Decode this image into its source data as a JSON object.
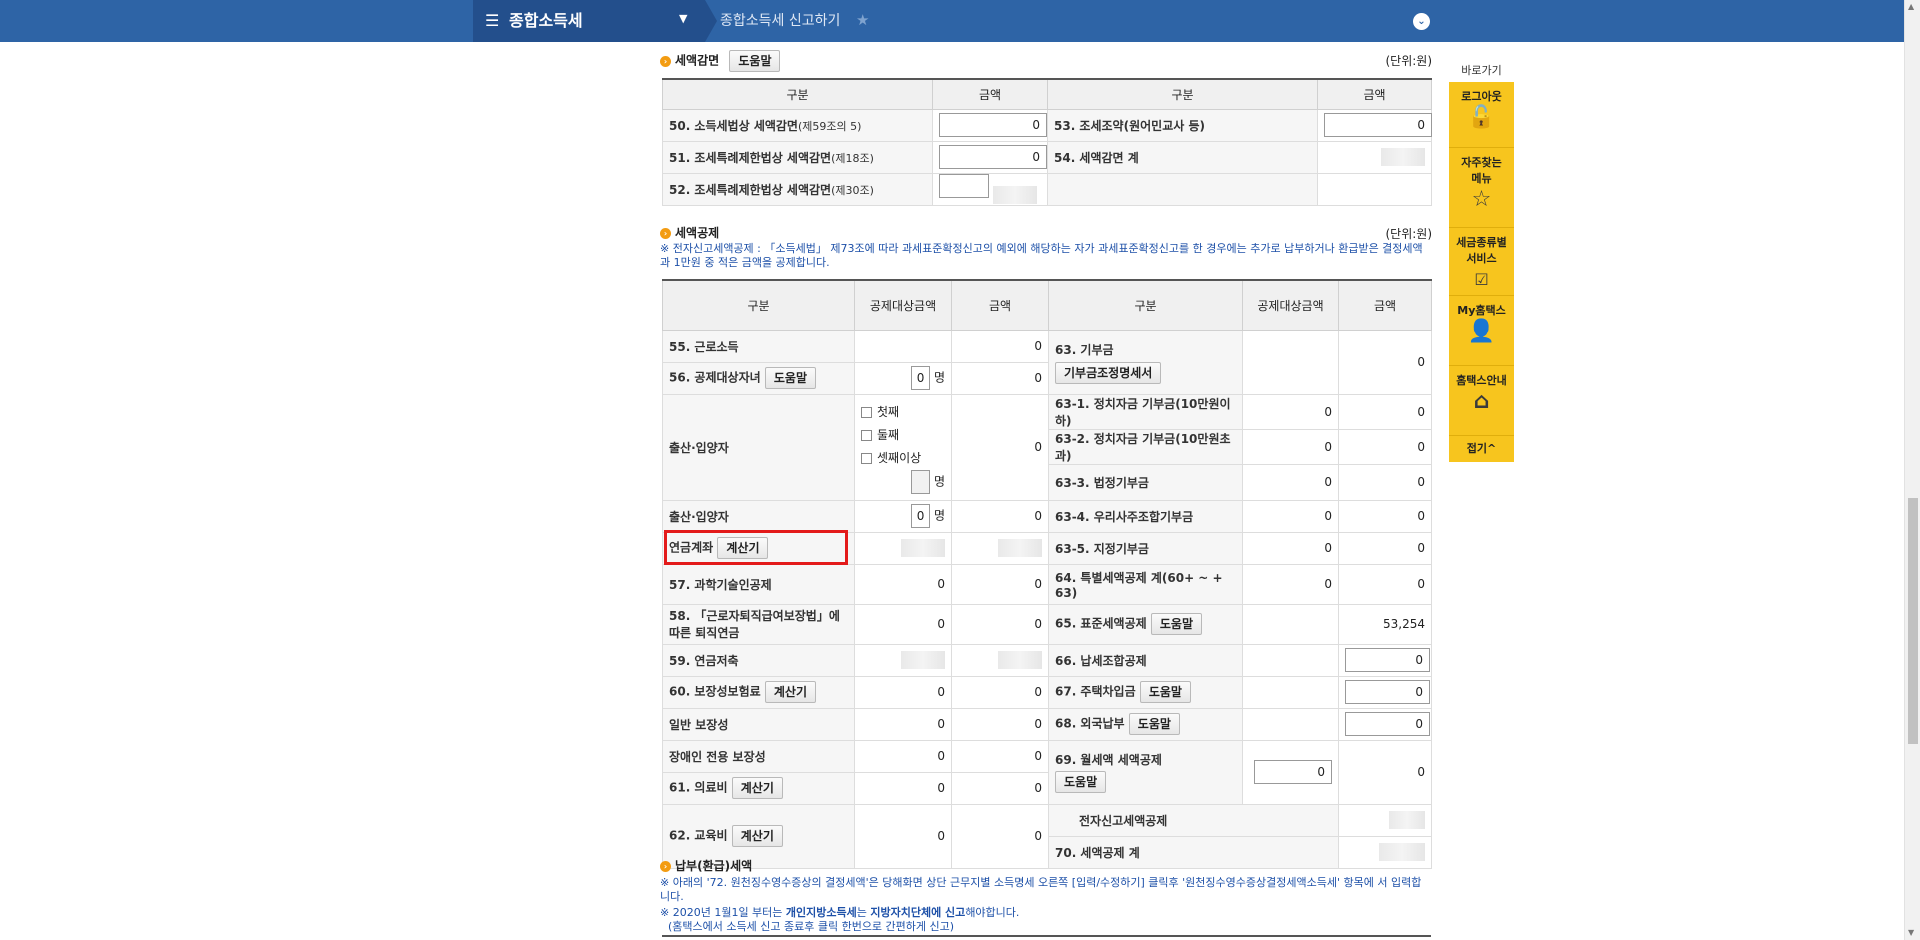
{
  "topbar": {
    "menu_icon": "☰",
    "menu_title": "종합소득세",
    "caret": "▼",
    "breadcrumb": "종합소득세 신고하기",
    "star": "★",
    "chevron": "⌄"
  },
  "reduction": {
    "title": "세액감면",
    "help": "도움말",
    "unit": "(단위:원)",
    "headers": [
      "구분",
      "금액",
      "구분",
      "금액"
    ],
    "r50_label": "50. 소득세법상 세액감면",
    "r50_small": "(제59조의 5)",
    "r50_value": "0",
    "r51_label": "51. 조세특례제한법상 세액감면",
    "r51_small": "(제18조)",
    "r51_value": "0",
    "r52_label": "52. 조세특례제한법상 세액감면",
    "r52_small": "(제30조)",
    "r53_label": "53. 조세조약(원어민교사 등)",
    "r53_value": "0",
    "r54_label": "54. 세액감면 계"
  },
  "deduction": {
    "title": "세액공제",
    "unit": "(단위:원)",
    "note": "※ 전자신고세액공제 : 「소득세법」 제73조에 따라 과세표준확정신고의 예외에 해당하는 자가 과세표준확정신고를 한 경우에는 추가로 납부하거나 환급받은 결정세액과 1만원 중 적은 금액을 공제합니다.",
    "headers": [
      "구분",
      "공제대상금액",
      "금액",
      "구분",
      "공제대상금액",
      "금액"
    ],
    "r55": "55. 근로소득",
    "r55_v": "0",
    "r56": "56. 공제대상자녀",
    "r56_btn": "도움말",
    "r56_count": "0",
    "r56_unit": "명",
    "r56_v": "0",
    "birth_label": "출산·입양자",
    "birth_opts": [
      "첫째",
      "둘째",
      "셋째이상"
    ],
    "birth_unit": "명",
    "birth_v": "0",
    "birth2_label": "출산·입양자",
    "birth2_count": "0",
    "birth2_unit": "명",
    "birth2_v": "0",
    "pension_label": "연금계좌",
    "pension_btn": "계산기",
    "r57": "57. 과학기술인공제",
    "r57_t": "0",
    "r57_v": "0",
    "r58": "58. 「근로자퇴직급여보장법」에 따른 퇴직연금",
    "r58_t": "0",
    "r58_v": "0",
    "r59": "59. 연금저축",
    "r60": "60. 보장성보험료",
    "r60_btn": "계산기",
    "r60_t": "0",
    "r60_v": "0",
    "gen_label": "일반 보장성",
    "gen_t": "0",
    "gen_v": "0",
    "dis_label": "장애인 전용 보장성",
    "dis_t": "0",
    "dis_v": "0",
    "r61": "61. 의료비",
    "r61_btn": "계산기",
    "r61_t": "0",
    "r61_v": "0",
    "r62": "62. 교육비",
    "r62_btn": "계산기",
    "r62_t": "0",
    "r62_v": "0",
    "r63": "63. 기부금",
    "r63_btn": "기부금조정명세서",
    "r63_v": "0",
    "r631": "63-1. 정치자금 기부금(10만원이하)",
    "r631_t": "0",
    "r631_v": "0",
    "r632": "63-2. 정치자금 기부금(10만원초과)",
    "r632_t": "0",
    "r632_v": "0",
    "r633": "63-3. 법정기부금",
    "r633_t": "0",
    "r633_v": "0",
    "r634": "63-4. 우리사주조합기부금",
    "r634_t": "0",
    "r634_v": "0",
    "r635": "63-5. 지정기부금",
    "r635_t": "0",
    "r635_v": "0",
    "r64": "64. 특별세액공제 계(60+ ~ + 63)",
    "r64_t": "0",
    "r64_v": "0",
    "r65": "65. 표준세액공제",
    "r65_btn": "도움말",
    "r65_v": "53,254",
    "r66": "66. 납세조합공제",
    "r66_v": "0",
    "r67": "67. 주택차입금",
    "r67_btn": "도움말",
    "r67_v": "0",
    "r68": "68. 외국납부",
    "r68_btn": "도움말",
    "r68_v": "0",
    "r69": "69. 월세액 세액공제",
    "r69_btn": "도움말",
    "r69_t": "0",
    "r69_v": "0",
    "e_label": "전자신고세액공제",
    "r70": "70. 세액공제 계"
  },
  "payment": {
    "title": "납부(환급)세액",
    "note1": "※ 아래의 '72. 원천징수영수증상의 결정세액'은 당해화면 상단 근무지별 소득명세 오른쪽 [입력/수정하기] 클릭후 '원천징수영수증상결정세액소득세' 항목에 서 입력합니다.",
    "note2_pre": "※ 2020년 1월1일 부터는 ",
    "note2_b1": "개인지방소득세",
    "note2_mid": "는 ",
    "note2_b2": "지방자치단체에 신고",
    "note2_post": "해야합니다.",
    "note3": "(홈택스에서 소득세 신고 종료후 클릭 한번으로 간편하게 신고)"
  },
  "quick": {
    "title": "바로가기",
    "logout": "로그아웃",
    "freq": "자주찾는 메뉴",
    "service": "세금종류별 서비스",
    "my": "My홈택스",
    "guide": "홈택스안내",
    "fold": "접기^"
  }
}
